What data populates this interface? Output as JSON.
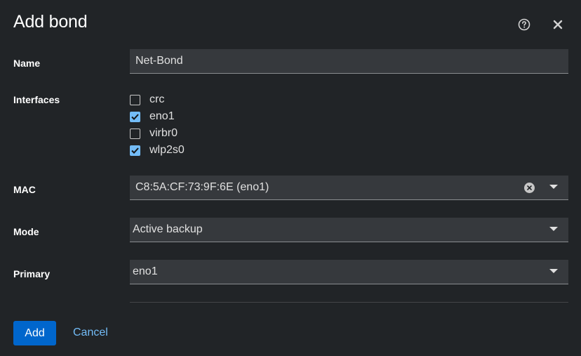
{
  "dialog": {
    "title": "Add bond",
    "help_icon": "help-circle-icon",
    "close_icon": "close-icon"
  },
  "form": {
    "name": {
      "label": "Name",
      "value": "Net-Bond"
    },
    "interfaces": {
      "label": "Interfaces",
      "items": [
        {
          "label": "crc",
          "checked": false
        },
        {
          "label": "eno1",
          "checked": true
        },
        {
          "label": "virbr0",
          "checked": false
        },
        {
          "label": "wlp2s0",
          "checked": true
        }
      ]
    },
    "mac": {
      "label": "MAC",
      "value": "C8:5A:CF:73:9F:6E (eno1)"
    },
    "mode": {
      "label": "Mode",
      "value": "Active backup"
    },
    "primary": {
      "label": "Primary",
      "value": "eno1"
    }
  },
  "actions": {
    "add_label": "Add",
    "cancel_label": "Cancel"
  },
  "colors": {
    "background": "#212427",
    "primary_button": "#0066cc",
    "link": "#73bcf7",
    "checkbox_checked": "#73bcf7"
  }
}
